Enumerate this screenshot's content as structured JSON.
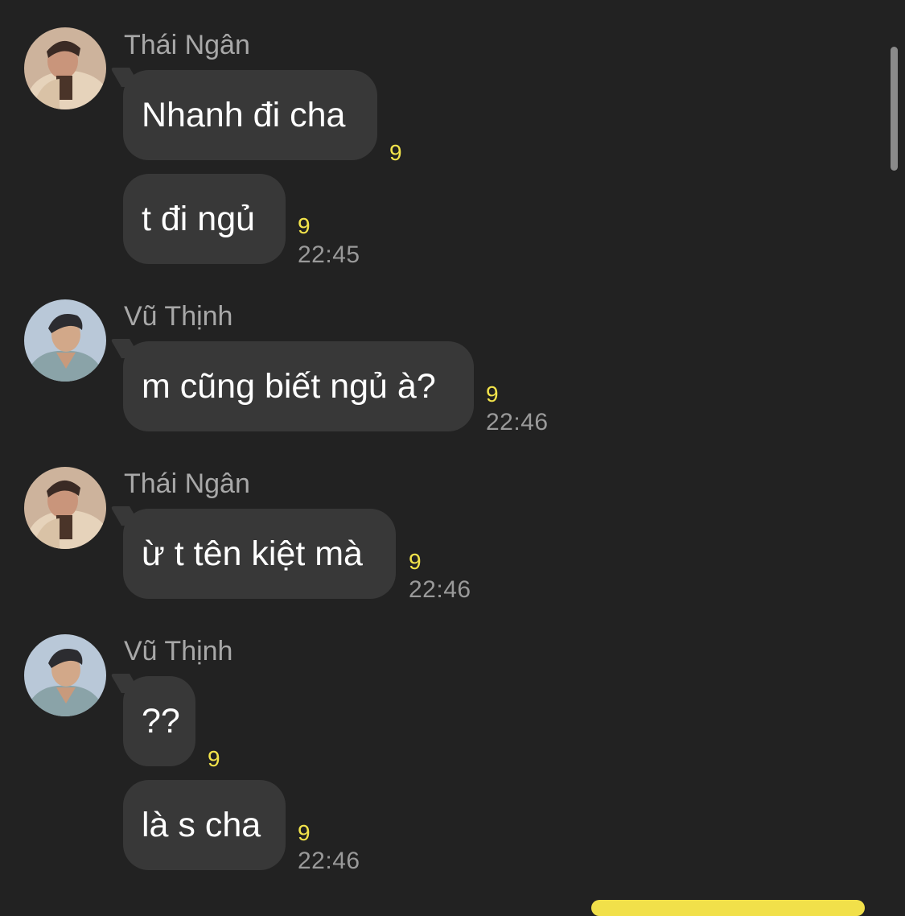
{
  "colors": {
    "background": "#222222",
    "bubble": "#383838",
    "message_text": "#ffffff",
    "sender_name": "#a8a8a8",
    "count": "#f3e44b",
    "timestamp": "#9a9a9a"
  },
  "groups": [
    {
      "sender": "Thái Ngân",
      "avatar": "avatar-thai-ngan",
      "messages": [
        {
          "text": "Nhanh đi cha",
          "count": "9",
          "time": ""
        },
        {
          "text": "t đi ngủ",
          "count": "9",
          "time": "22:45"
        }
      ]
    },
    {
      "sender": "Vũ Thịnh",
      "avatar": "avatar-vu-thinh",
      "messages": [
        {
          "text": "m cũng biết ngủ à?",
          "count": "9",
          "time": "22:46"
        }
      ]
    },
    {
      "sender": "Thái Ngân",
      "avatar": "avatar-thai-ngan",
      "messages": [
        {
          "text": "ừ t tên kiệt mà",
          "count": "9",
          "time": "22:46"
        }
      ]
    },
    {
      "sender": "Vũ Thịnh",
      "avatar": "avatar-vu-thinh",
      "messages": [
        {
          "text": "??",
          "count": "9",
          "time": ""
        },
        {
          "text": "là s cha",
          "count": "9",
          "time": "22:46"
        }
      ]
    }
  ]
}
